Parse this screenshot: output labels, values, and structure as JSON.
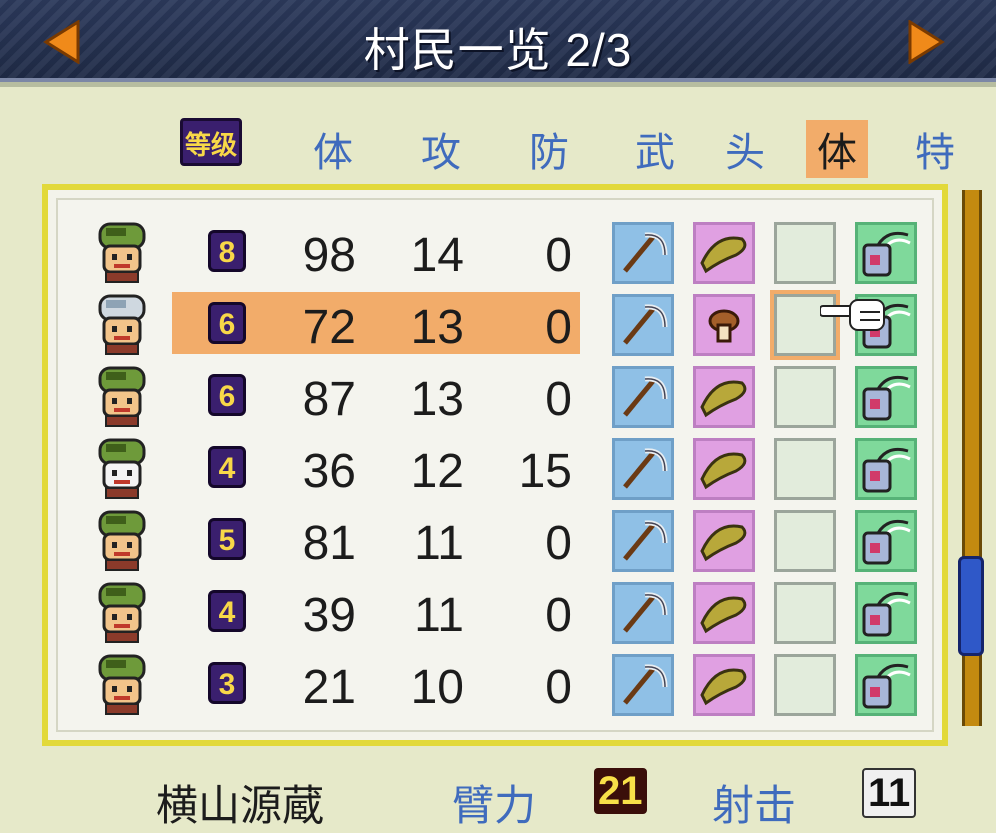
{
  "title": "村民一览 2/3",
  "headers": {
    "level_badge": "等级",
    "cols": [
      "体",
      "攻",
      "防",
      "武",
      "头",
      "体",
      "特"
    ],
    "active_index": 5
  },
  "rows": [
    {
      "level": "8",
      "hp": "98",
      "atk": "14",
      "def": "0"
    },
    {
      "level": "6",
      "hp": "72",
      "atk": "13",
      "def": "0"
    },
    {
      "level": "6",
      "hp": "87",
      "atk": "13",
      "def": "0"
    },
    {
      "level": "4",
      "hp": "36",
      "atk": "12",
      "def": "15"
    },
    {
      "level": "5",
      "hp": "81",
      "atk": "11",
      "def": "0"
    },
    {
      "level": "4",
      "hp": "39",
      "atk": "11",
      "def": "0"
    },
    {
      "level": "3",
      "hp": "21",
      "atk": "10",
      "def": "0"
    }
  ],
  "selected_row_index": 1,
  "bottom": {
    "name": "横山源蔵",
    "str_label": "臂力",
    "str_value": "21",
    "shoot_label": "射击",
    "shoot_value": "11"
  },
  "icons": {
    "weapon": "sickle-icon",
    "head": "straw-hat-icon",
    "head_selected_row": "mushroom-icon",
    "body": "empty-slot",
    "special": "amulet-icon"
  },
  "colors": {
    "accent": "#f2ac6a",
    "header_blue": "#3f6bbd",
    "level_purple": "#3a1f6e",
    "level_yellow": "#f8d848"
  }
}
